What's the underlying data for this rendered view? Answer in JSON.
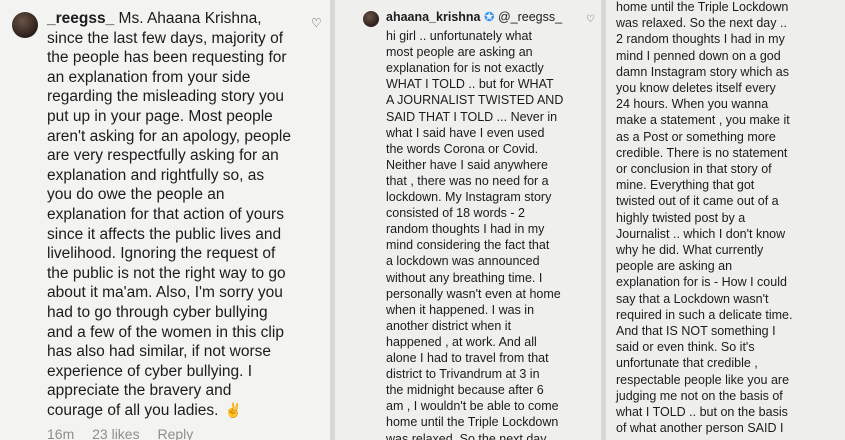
{
  "left_comment": {
    "username": "_reegss_",
    "lines": [
      "Ms. Ahaana Krishna,",
      "since the last few days, majority of",
      "the people has been requesting for",
      "an explanation from your side",
      "regarding the misleading story you",
      "put up in your page. Most people",
      "aren't asking for an apology, people",
      "are very respectfully asking for an",
      "explanation and rightfully so, as",
      "you do owe the people an",
      "explanation for that action of yours",
      "since it affects the public lives and",
      "livelihood. Ignoring the request of",
      "the public is not the right way to go",
      "about it ma'am. Also, I'm sorry you",
      "had to go through cyber bullying",
      "and a few of the women in this clip",
      "has also had similar, if not worse",
      "experience of cyber bullying. I",
      "appreciate the bravery and",
      "courage of all you ladies."
    ],
    "emoji": "✌",
    "time": "16m",
    "likes": "23 likes",
    "reply": "Reply"
  },
  "middle_comment": {
    "username": "ahaana_krishna",
    "verified_icon": "✪",
    "mention": "@_reegss_",
    "lines": [
      "hi girl .. unfortunately what",
      "most people are asking an",
      "explanation for is not exactly",
      "WHAT I TOLD .. but for WHAT",
      "A JOURNALIST TWISTED AND",
      "SAID THAT I TOLD ... Never in",
      "what I said have I even used",
      "the words Corona or Covid.",
      "Neither have I said anywhere",
      "that , there was no need for a",
      "lockdown. My Instagram story",
      "consisted of 18 words - 2",
      "random thoughts I had in my",
      "mind considering the fact that",
      "a lockdown was announced",
      "without any breathing time. I",
      "personally wasn't even at home",
      "when it happened. I was in",
      "another district when it",
      "happened , at work. And all",
      "alone I had to travel from that",
      "district to Trivandrum at 3 in",
      "the midnight because after 6",
      "am , I wouldn't be able to come",
      "home until the Triple Lockdown",
      "was relaxed. So the next day .."
    ]
  },
  "right_comment": {
    "lines": [
      "home until the Triple Lockdown",
      "was relaxed. So the next day ..",
      "2 random thoughts I had in my",
      "mind I penned down on a god",
      "damn Instagram story which as",
      "you know deletes itself every",
      "24 hours. When you wanna",
      "make a statement , you make it",
      "as a Post or something more",
      "credible. There is no statement",
      "or conclusion in that story of",
      "mine. Everything that got",
      "twisted out of it came out of a",
      "highly twisted post by a",
      "Journalist .. which I don't know",
      "why he did. What currently",
      "people are asking an",
      "explanation for is - How I could",
      "say that a Lockdown wasn't",
      "required in such a delicate time.",
      "And that IS NOT something I",
      "said or even think. So it's",
      "unfortunate that credible ,",
      "respectable people like you are",
      "judging me not on the basis of",
      "what I TOLD .. but on the basis",
      "of what another person SAID I"
    ]
  }
}
